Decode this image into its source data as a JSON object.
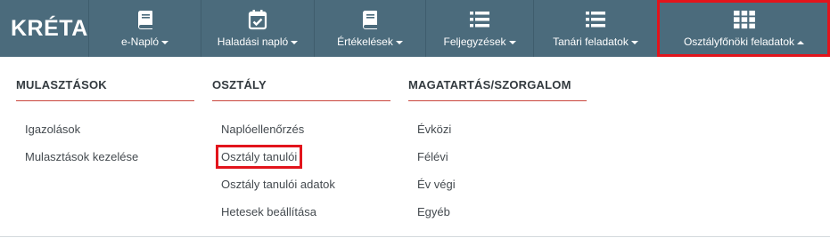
{
  "brand": {
    "name": "KRÉTA"
  },
  "nav": [
    {
      "label": "e-Napló",
      "icon": "book-icon",
      "active": false
    },
    {
      "label": "Haladási napló",
      "icon": "calendar-check-icon",
      "active": false
    },
    {
      "label": "Értékelések",
      "icon": "book-icon",
      "active": false
    },
    {
      "label": "Feljegyzések",
      "icon": "list-icon",
      "active": false
    },
    {
      "label": "Tanári feladatok",
      "icon": "list-icon",
      "active": false
    },
    {
      "label": "Osztályfőnöki feladatok",
      "icon": "grid-icon",
      "active": true
    }
  ],
  "dropdown": {
    "columns": [
      {
        "heading": "MULASZTÁSOK",
        "items": [
          "Igazolások",
          "Mulasztások kezelése"
        ]
      },
      {
        "heading": "OSZTÁLY",
        "items": [
          "Naplóellenőrzés",
          "Osztály tanulói",
          "Osztály tanulói adatok",
          "Hetesek beállítása"
        ]
      },
      {
        "heading": "MAGATARTÁS/SZORGALOM",
        "items": [
          "Évközi",
          "Félévi",
          "Év végi",
          "Egyéb"
        ]
      }
    ],
    "highlighted_item": "Osztály tanulói"
  },
  "colors": {
    "navbar": "#4b6b7c",
    "highlight": "#e2141c",
    "divider": "#c9453c"
  }
}
